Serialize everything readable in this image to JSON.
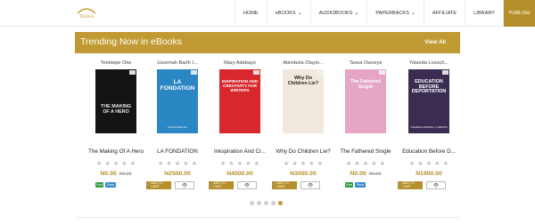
{
  "header": {
    "logo_text": "TEEKA",
    "nav": [
      {
        "label": "HOME",
        "dropdown": false
      },
      {
        "label": "eBOOKS",
        "dropdown": true
      },
      {
        "label": "AUDIOBOOKS",
        "dropdown": true
      },
      {
        "label": "PAPERBACKS",
        "dropdown": true
      },
      {
        "label": "AFFILIATE",
        "dropdown": false
      },
      {
        "label": "LIBRARY",
        "dropdown": false
      },
      {
        "label": "PUBLISH",
        "dropdown": false
      }
    ]
  },
  "banner": {
    "title": "Trending Now in eBooks",
    "link": "View All"
  },
  "colors": {
    "accent": "#c29a33",
    "free": "#2e9e3e",
    "read": "#3a87c8"
  },
  "books": [
    {
      "author": "Temitope Oke",
      "title": "The Making Of A Hero",
      "price": "N0.00",
      "old_price": "N0.00",
      "rating": 0,
      "actions": [
        "free",
        "read"
      ],
      "labels": {
        "free": "Free",
        "read": "Read",
        "add": "ADD TO CART"
      },
      "cover": {
        "bg": "#141414",
        "text": "THE MAKING OF A HERO",
        "color": "#e6e6e6"
      }
    },
    {
      "author": "Uzormah Barth I...",
      "title": "LA FONDATION",
      "price": "N2500.00",
      "old_price": "",
      "rating": 0,
      "actions": [
        "cart",
        "view"
      ],
      "labels": {
        "free": "Free",
        "read": "Read",
        "add": "ADD TO CART"
      },
      "cover": {
        "bg": "#2b86c4",
        "text": "LA FONDATION",
        "color": "#ffffff",
        "sub": "Uzormah Barth Ike"
      }
    },
    {
      "author": "Mary Adebayo",
      "title": "Inkspiration And Cr...",
      "price": "N4000.00",
      "old_price": "",
      "rating": 0,
      "actions": [
        "cart",
        "view"
      ],
      "labels": {
        "free": "Free",
        "read": "Read",
        "add": "ADD TO CART"
      },
      "cover": {
        "bg": "#d8282d",
        "text": "INSPIRATION AND CREATIVITY FOR WRITERS",
        "color": "#ffffff"
      }
    },
    {
      "author": "Abimbola Olayin...",
      "title": "Why Do Children Lie?",
      "price": "N3000.00",
      "old_price": "",
      "rating": 0,
      "actions": [
        "cart",
        "view"
      ],
      "labels": {
        "free": "Free",
        "read": "Read",
        "add": "ADD TO CART"
      },
      "cover": {
        "bg": "#f1e9dd",
        "text": "Why Do Children Lie?",
        "color": "#1f1f1f"
      }
    },
    {
      "author": "'Sewa Owoeye",
      "title": "The Fathered Single",
      "price": "N0.00",
      "old_price": "N0.00",
      "rating": 0,
      "actions": [
        "free",
        "read"
      ],
      "labels": {
        "free": "Free",
        "read": "Read",
        "add": "ADD TO CART"
      },
      "cover": {
        "bg": "#e4a6c4",
        "text": "The Fathered Single",
        "color": "#ffffff"
      }
    },
    {
      "author": "Yolanda Losoch...",
      "title": "Education Before D...",
      "price": "N1900.00",
      "old_price": "",
      "rating": 0,
      "actions": [
        "cart",
        "view"
      ],
      "labels": {
        "free": "Free",
        "read": "Read",
        "add": "ADD TO CART"
      },
      "cover": {
        "bg": "#3b2d52",
        "text": "EDUCATION BEFORE DEPORTATION",
        "color": "#ffffff",
        "sub": "YOLANDA LOSOCHA, C. NAROCK"
      }
    }
  ],
  "carousel": {
    "pages": 5,
    "active": 4
  }
}
